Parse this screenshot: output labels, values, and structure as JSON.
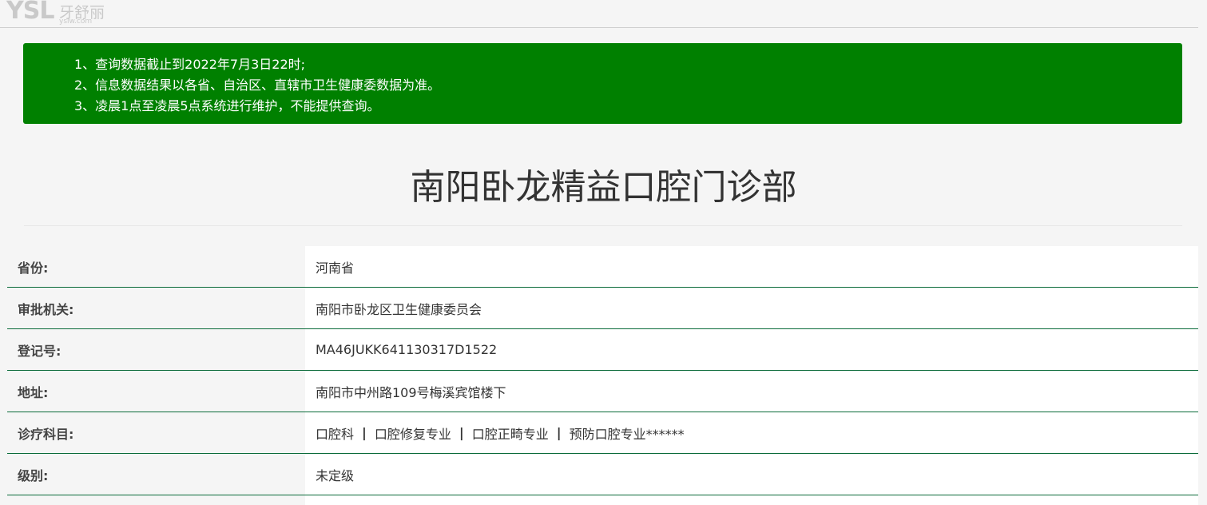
{
  "header": {
    "logo_text": "YSL",
    "logo_cn": "牙舒丽",
    "logo_url": "yslw.com"
  },
  "notice": {
    "lines": [
      "1、查询数据截止到2022年7月3日22时;",
      "2、信息数据结果以各省、自治区、直辖市卫生健康委数据为准。",
      "3、凌晨1点至凌晨5点系统进行维护，不能提供查询。"
    ],
    "bg_color": "#008000"
  },
  "page_title": "南阳卧龙精益口腔门诊部",
  "info": {
    "province_label": "省份:",
    "province": "河南省",
    "authority_label": "审批机关:",
    "authority": "南阳市卧龙区卫生健康委员会",
    "reg_label": "登记号:",
    "reg_no": "MA46JUKK641130317D1522",
    "address_label": "地址:",
    "address": "南阳市中州路109号梅溪宾馆楼下",
    "subjects_label": "诊疗科目:",
    "subjects": [
      "口腔科",
      "口腔修复专业",
      "口腔正畸专业",
      "预防口腔专业******"
    ],
    "subject_separator": "|",
    "level_label": "级别:",
    "level": "未定级"
  }
}
